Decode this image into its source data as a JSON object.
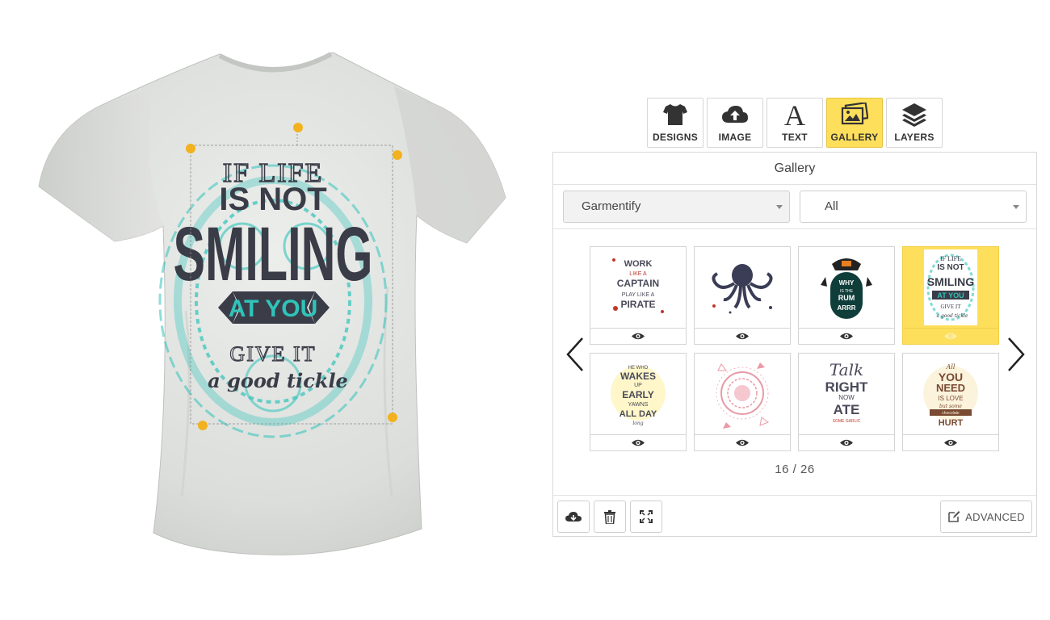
{
  "toolbar": {
    "tabs": [
      {
        "label": "DESIGNS",
        "icon": "tshirt-icon"
      },
      {
        "label": "IMAGE",
        "icon": "cloud-upload-icon"
      },
      {
        "label": "TEXT",
        "icon": "text-icon"
      },
      {
        "label": "GALLERY",
        "icon": "gallery-icon",
        "active": true
      },
      {
        "label": "LAYERS",
        "icon": "layers-icon"
      }
    ],
    "active_color": "#fedf5c"
  },
  "preview": {
    "design_lines": [
      "IF LIFE",
      "IS NOT",
      "SMILING",
      "AT YOU",
      "GIVE IT",
      "a good tickle"
    ],
    "colors": {
      "shirt": "#dfe0de",
      "ink": "#3a3d48",
      "accent": "#2fc3b9",
      "handle": "#f2b21f"
    }
  },
  "gallery": {
    "title": "Gallery",
    "source_select": "Garmentify",
    "category_select": "All",
    "items": [
      {
        "lines": [
          "WORK",
          "LIKE A",
          "CAPTAIN",
          "PLAY LIKE A",
          "PIRATE"
        ],
        "active": false
      },
      {
        "lines": [],
        "icon": "octopus-icon",
        "active": false
      },
      {
        "lines": [
          "WHY",
          "IS THE",
          "RUM",
          "ARRR"
        ],
        "active": false
      },
      {
        "lines": [
          "IF LIFE",
          "IS NOT",
          "SMILING",
          "AT YOU",
          "GIVE IT",
          "a good tickle"
        ],
        "active": true
      },
      {
        "lines": [
          "HE WHO",
          "WAKES",
          "UP",
          "EARLY",
          "YAWNS",
          "ALL DAY",
          "long"
        ],
        "active": false
      },
      {
        "lines": [],
        "icon": "mandala-icon",
        "active": false
      },
      {
        "lines": [
          "Talk",
          "RIGHT",
          "NOW",
          "ATE",
          "SOME GARLIC"
        ],
        "active": false
      },
      {
        "lines": [
          "All",
          "YOU",
          "NEED",
          "IS LOVE",
          "but some",
          "chocolate",
          "HURT"
        ],
        "active": false
      }
    ],
    "page_current": "16",
    "page_separator": "/",
    "page_total": "26",
    "advanced_label": "ADVANCED"
  }
}
